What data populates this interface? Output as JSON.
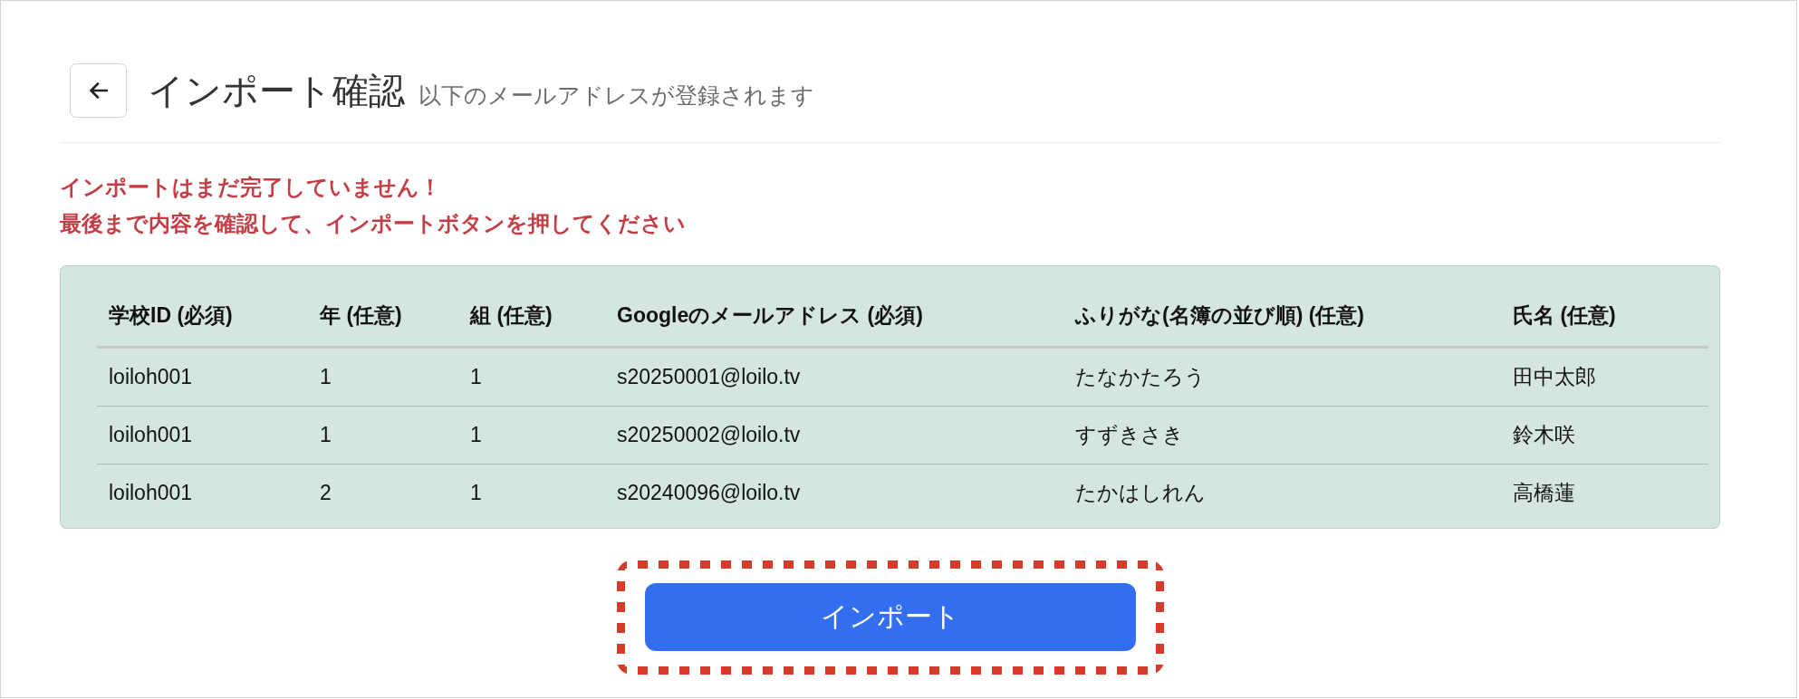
{
  "header": {
    "title": "インポート確認",
    "subtitle": "以下のメールアドレスが登録されます"
  },
  "warning": [
    "インポートはまだ完了していません！",
    "最後まで内容を確認して、インポートボタンを押してください"
  ],
  "table": {
    "columns": [
      "学校ID (必須)",
      "年 (任意)",
      "組 (任意)",
      "Googleのメールアドレス (必須)",
      "ふりがな(名簿の並び順) (任意)",
      "氏名 (任意)"
    ],
    "rows": [
      [
        "loiloh001",
        "1",
        "1",
        "s20250001@loilo.tv",
        "たなかたろう",
        "田中太郎"
      ],
      [
        "loiloh001",
        "1",
        "1",
        "s20250002@loilo.tv",
        "すずきさき",
        "鈴木咲"
      ],
      [
        "loiloh001",
        "2",
        "1",
        "s20240096@loilo.tv",
        "たかはしれん",
        "高橋蓮"
      ]
    ]
  },
  "import_button": {
    "label": "インポート",
    "highlighted": true
  }
}
